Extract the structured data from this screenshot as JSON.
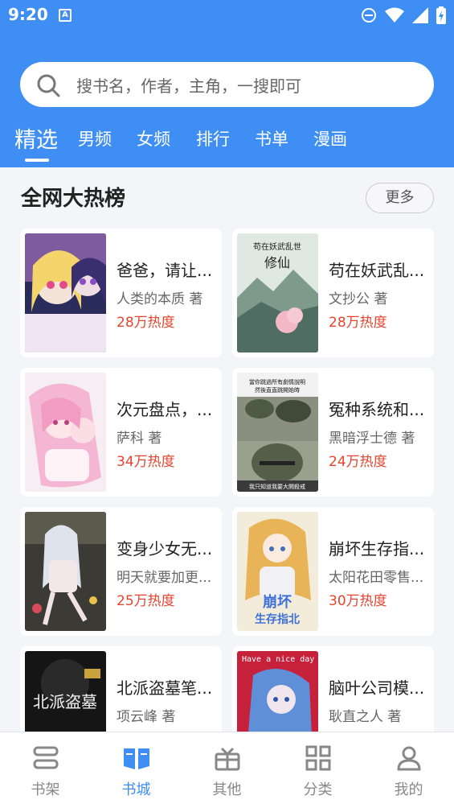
{
  "status": {
    "time": "9:20",
    "badge": "A"
  },
  "search": {
    "placeholder": "搜书名，作者，主角，一搜即可"
  },
  "tabs": [
    {
      "label": "精选",
      "active": true
    },
    {
      "label": "男频"
    },
    {
      "label": "女频"
    },
    {
      "label": "排行"
    },
    {
      "label": "书单"
    },
    {
      "label": "漫画"
    }
  ],
  "section": {
    "title": "全网大热榜",
    "more_label": "更多"
  },
  "books": [
    {
      "title": "爸爸，请让...",
      "author": "人类的本质 著",
      "heat": "28万热度"
    },
    {
      "title": "苟在妖武乱...",
      "author": "文抄公 著",
      "heat": "28万热度",
      "cover_text": "苟在妖武乱世修仙"
    },
    {
      "title": "次元盘点，...",
      "author": "萨科 著",
      "heat": "34万热度"
    },
    {
      "title": "冤种系统和...",
      "author": "黑暗浮士德 著",
      "heat": "24万热度",
      "cover_text": "當你跳過所有劇情說明 然後直直跳開始時",
      "cover_caption": "我只知道我要大開殺戒"
    },
    {
      "title": "变身少女无...",
      "author": "明天就要加更...",
      "heat": "25万热度"
    },
    {
      "title": "崩坏生存指...",
      "author": "太阳花田零售...",
      "heat": "30万热度",
      "cover_text": "崩坏生存指北"
    },
    {
      "title": "北派盗墓笔...",
      "author": "项云峰 著",
      "heat": "",
      "cover_text": "北派盗墓"
    },
    {
      "title": "脑叶公司模...",
      "author": "耿直之人 著",
      "heat": "",
      "cover_text": "Have a nice day"
    }
  ],
  "bottom_nav": [
    {
      "label": "书架",
      "icon": "bookshelf-icon"
    },
    {
      "label": "书城",
      "icon": "open-book-icon",
      "active": true
    },
    {
      "label": "其他",
      "icon": "gift-icon"
    },
    {
      "label": "分类",
      "icon": "grid-icon"
    },
    {
      "label": "我的",
      "icon": "user-icon"
    }
  ],
  "colors": {
    "brand": "#3e8ef3",
    "heat": "#e5442e"
  }
}
